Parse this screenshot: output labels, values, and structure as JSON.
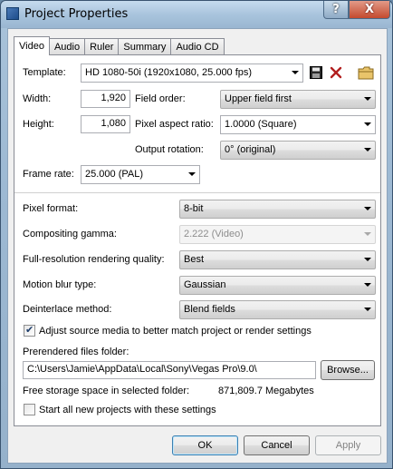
{
  "window": {
    "title": "Project Properties",
    "help_label": "?",
    "close_label": "X"
  },
  "tabs": [
    {
      "label": "Video",
      "active": true
    },
    {
      "label": "Audio",
      "active": false
    },
    {
      "label": "Ruler",
      "active": false
    },
    {
      "label": "Summary",
      "active": false
    },
    {
      "label": "Audio CD",
      "active": false
    }
  ],
  "video": {
    "template_label": "Template:",
    "template_value": "HD 1080-50i (1920x1080, 25.000 fps)",
    "width_label": "Width:",
    "width_value": "1,920",
    "height_label": "Height:",
    "height_value": "1,080",
    "field_order_label": "Field order:",
    "field_order_value": "Upper field first",
    "pixel_aspect_label": "Pixel aspect ratio:",
    "pixel_aspect_value": "1.0000 (Square)",
    "output_rotation_label": "Output rotation:",
    "output_rotation_value": "0° (original)",
    "frame_rate_label": "Frame rate:",
    "frame_rate_value": "25.000 (PAL)",
    "pixel_format_label": "Pixel format:",
    "pixel_format_value": "8-bit",
    "compositing_gamma_label": "Compositing gamma:",
    "compositing_gamma_value": "2.222 (Video)",
    "full_res_label": "Full-resolution rendering quality:",
    "full_res_value": "Best",
    "motion_blur_label": "Motion blur type:",
    "motion_blur_value": "Gaussian",
    "deinterlace_label": "Deinterlace method:",
    "deinterlace_value": "Blend fields",
    "adjust_source_label": "Adjust source media to better match project or render settings",
    "adjust_source_checked": true,
    "prerendered_label": "Prerendered files folder:",
    "prerendered_value": "C:\\Users\\Jamie\\AppData\\Local\\Sony\\Vegas Pro\\9.0\\",
    "browse_label": "Browse...",
    "free_storage_label": "Free storage space in selected folder:",
    "free_storage_value": "871,809.7 Megabytes",
    "start_all_label": "Start all new projects with these settings",
    "start_all_checked": false
  },
  "buttons": {
    "ok": "OK",
    "cancel": "Cancel",
    "apply": "Apply"
  },
  "icons": {
    "save": "save-icon",
    "delete": "delete-icon",
    "folder": "folder-icon"
  }
}
